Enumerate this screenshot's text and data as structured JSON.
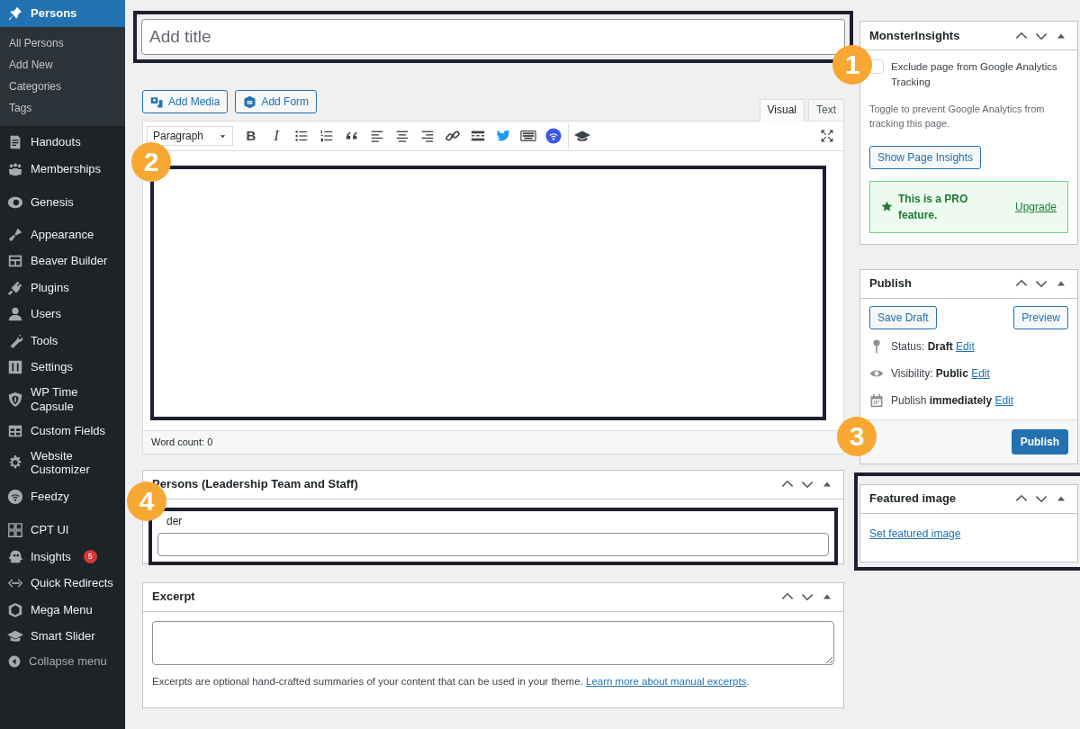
{
  "sidebar": {
    "items": [
      {
        "label": "Persons",
        "selected": true,
        "children": [
          {
            "label": "All Persons",
            "selected": false
          },
          {
            "label": "Add New",
            "selected": false
          },
          {
            "label": "Categories",
            "selected": false
          },
          {
            "label": "Tags",
            "selected": false
          }
        ]
      },
      {
        "label": "Handouts",
        "selected": false
      },
      {
        "label": "Memberships",
        "selected": false
      },
      {
        "label": "Genesis",
        "selected": false
      },
      {
        "label": "Appearance",
        "selected": false
      },
      {
        "label": "Beaver Builder",
        "selected": false
      },
      {
        "label": "Plugins",
        "selected": false
      },
      {
        "label": "Users",
        "selected": false
      },
      {
        "label": "Tools",
        "selected": false
      },
      {
        "label": "Settings",
        "selected": false
      },
      {
        "label": "WP Time Capsule",
        "selected": false
      },
      {
        "label": "Custom Fields",
        "selected": false
      },
      {
        "label": "Website Customizer",
        "selected": false
      },
      {
        "label": "Feedzy",
        "selected": false
      },
      {
        "label": "CPT UI",
        "selected": false
      },
      {
        "label": "Insights",
        "selected": false,
        "badge": "5"
      },
      {
        "label": "Quick Redirects",
        "selected": false
      },
      {
        "label": "Mega Menu",
        "selected": false
      },
      {
        "label": "Smart Slider",
        "selected": false
      }
    ],
    "collapse_label": "Collapse menu"
  },
  "title_field": {
    "placeholder": "Add title"
  },
  "media_buttons": [
    "Add Media",
    "Add Form"
  ],
  "editor_tabs": [
    {
      "label": "Visual",
      "selected": true
    },
    {
      "label": "Text",
      "selected": false
    }
  ],
  "toolbar": {
    "format_select": "Paragraph",
    "bold": "B",
    "italic": "I"
  },
  "word_count": "Word count: 0",
  "persons_box": {
    "title": "Persons (Leadership Team and Staff)",
    "field_label": "der"
  },
  "excerpt_box": {
    "title": "Excerpt",
    "help": "Excerpts are optional hand-crafted summaries of your content that can be used in your theme. ",
    "link": "Learn more about manual excerpts",
    "after": "."
  },
  "monsterinsights": {
    "title": "MonsterInsights",
    "checkbox": {
      "label": "Exclude page from Google Analytics Tracking",
      "checked": false
    },
    "help": "Toggle to prevent Google Analytics from tracking this page.",
    "button": "Show Page Insights",
    "pro_text": "This is a PRO feature.",
    "pro_link": "Upgrade"
  },
  "publish": {
    "title": "Publish",
    "save_button": "Save Draft",
    "preview_button": "Preview",
    "rows": [
      {
        "label": "Status: ",
        "value": "Draft",
        "link": "Edit"
      },
      {
        "label": "Visibility: ",
        "value": "Public",
        "link": "Edit"
      },
      {
        "label": "Publish ",
        "value": "immediately",
        "link": "Edit"
      }
    ],
    "publish_button": "Publish"
  },
  "featured_image": {
    "title": "Featured image",
    "link": "Set featured image"
  },
  "callouts": [
    "1",
    "2",
    "3",
    "4"
  ]
}
